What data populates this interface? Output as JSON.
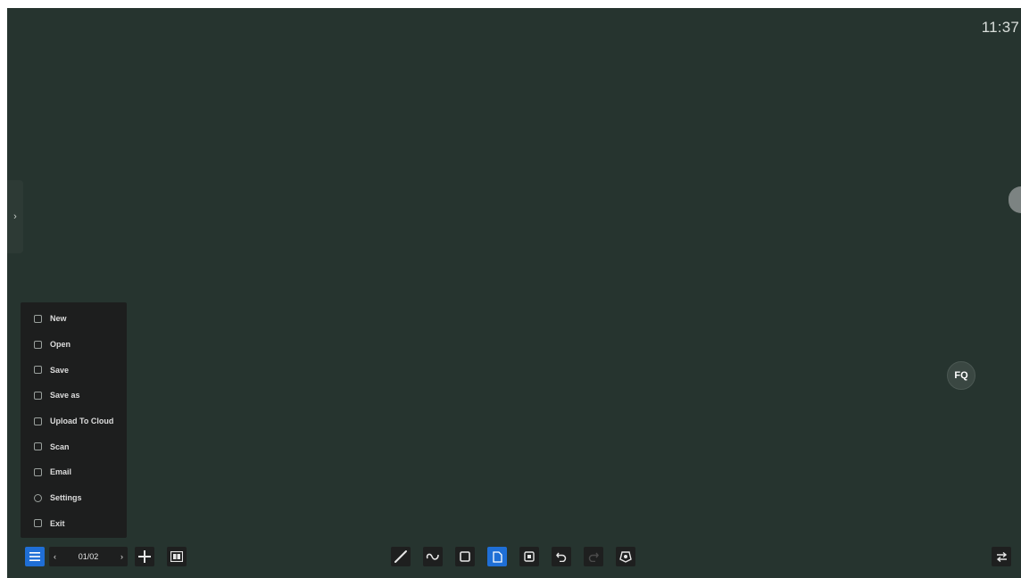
{
  "status": {
    "time": "11:37"
  },
  "menu": {
    "items": [
      {
        "label": "New",
        "icon": "new-file-icon"
      },
      {
        "label": "Open",
        "icon": "open-folder-icon"
      },
      {
        "label": "Save",
        "icon": "save-icon"
      },
      {
        "label": "Save as",
        "icon": "save-as-icon"
      },
      {
        "label": "Upload To Cloud",
        "icon": "cloud-upload-icon"
      },
      {
        "label": "Scan",
        "icon": "scan-icon"
      },
      {
        "label": "Email",
        "icon": "email-icon"
      },
      {
        "label": "Settings",
        "icon": "settings-icon"
      },
      {
        "label": "Exit",
        "icon": "exit-icon"
      }
    ]
  },
  "pager": {
    "label": "01/02",
    "prev_glyph": "‹",
    "next_glyph": "›"
  },
  "float_button": {
    "label": "FQ"
  },
  "colors": {
    "board": "#26342f",
    "accent": "#1f6fd6",
    "toolbar": "#1e1f1f"
  }
}
